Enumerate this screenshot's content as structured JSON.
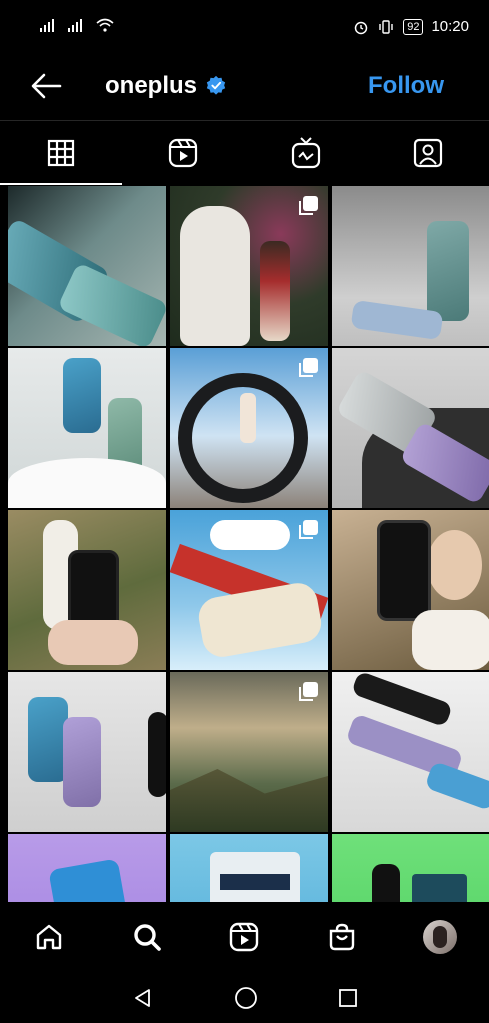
{
  "status": {
    "battery": "92",
    "time": "10:20"
  },
  "header": {
    "username": "oneplus",
    "follow_label": "Follow"
  },
  "tabs": [
    {
      "name": "posts",
      "active": true
    },
    {
      "name": "reels",
      "active": false
    },
    {
      "name": "igtv",
      "active": false
    },
    {
      "name": "tagged",
      "active": false
    }
  ],
  "colors": {
    "accent": "#3897f0",
    "background": "#000000",
    "text": "#ffffff"
  },
  "icons": {
    "tabs": [
      "grid-icon",
      "reels-icon",
      "igtv-icon",
      "tagged-icon"
    ],
    "bottom_nav": [
      "home-icon",
      "search-icon",
      "reels-icon",
      "shop-icon",
      "profile-avatar"
    ],
    "system_nav": [
      "back-triangle-icon",
      "home-circle-icon",
      "recents-square-icon"
    ]
  },
  "grid_tiles": [
    {
      "subject": "phones-green-gradient",
      "multi": false
    },
    {
      "subject": "white-horse-woman",
      "multi": true
    },
    {
      "subject": "phones-grey",
      "multi": false
    },
    {
      "subject": "phones-blue-green",
      "multi": false
    },
    {
      "subject": "ring-jump",
      "multi": true
    },
    {
      "subject": "phones-silver-purple",
      "multi": false
    },
    {
      "subject": "woman-field-phone",
      "multi": false
    },
    {
      "subject": "dancer-sky",
      "multi": true
    },
    {
      "subject": "woman-selfie",
      "multi": false
    },
    {
      "subject": "phones-blue-purple-black",
      "multi": false
    },
    {
      "subject": "mountain-valley",
      "multi": true
    },
    {
      "subject": "phones-diagonal",
      "multi": false
    },
    {
      "subject": "phone-purple-bg",
      "multi": false
    },
    {
      "subject": "oneplus-9-series-box",
      "multi": false
    },
    {
      "subject": "phone-green-bg",
      "multi": false
    }
  ]
}
